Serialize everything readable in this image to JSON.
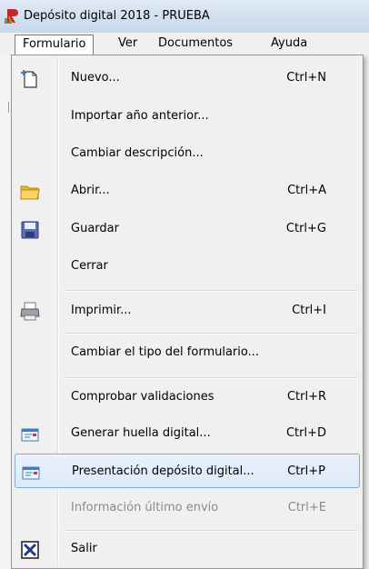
{
  "window": {
    "title": "Depósito digital 2018 - PRUEBA",
    "app_icon": "red-app-icon"
  },
  "menubar": {
    "items": [
      {
        "label": "Formulario",
        "active": true
      },
      {
        "label": "Ver"
      },
      {
        "label": "Documentos"
      },
      {
        "label": "Ayuda"
      }
    ]
  },
  "menu": {
    "items": [
      {
        "label": "Nuevo...",
        "shortcut": "Ctrl+N",
        "icon": "new-document-icon"
      },
      {
        "label": "Importar año anterior...",
        "shortcut": ""
      },
      {
        "label": "Cambiar descripción...",
        "shortcut": ""
      },
      {
        "label": "Abrir...",
        "shortcut": "Ctrl+A",
        "icon": "folder-icon"
      },
      {
        "label": "Guardar",
        "shortcut": "Ctrl+G",
        "icon": "save-icon"
      },
      {
        "label": "Cerrar",
        "shortcut": ""
      },
      {
        "label": "Imprimir...",
        "shortcut": "Ctrl+I",
        "icon": "printer-icon"
      },
      {
        "label": "Cambiar el tipo del formulario...",
        "shortcut": ""
      },
      {
        "label": "Comprobar validaciones",
        "shortcut": "Ctrl+R"
      },
      {
        "label": "Generar huella digital...",
        "shortcut": "Ctrl+D",
        "icon": "fingerprint-card-icon"
      },
      {
        "label": "Presentación depósito digital...",
        "shortcut": "Ctrl+P",
        "icon": "submit-card-icon",
        "highlighted": true
      },
      {
        "label": "Información último envío",
        "shortcut": "Ctrl+E",
        "disabled": true
      },
      {
        "label": "Salir",
        "shortcut": "",
        "icon": "exit-icon"
      }
    ]
  },
  "colors": {
    "highlight_border": "#85acd8",
    "highlight_fill": "#dbe9f8",
    "disabled_text": "#8a8a8a",
    "accent_red": "#c0392b"
  }
}
